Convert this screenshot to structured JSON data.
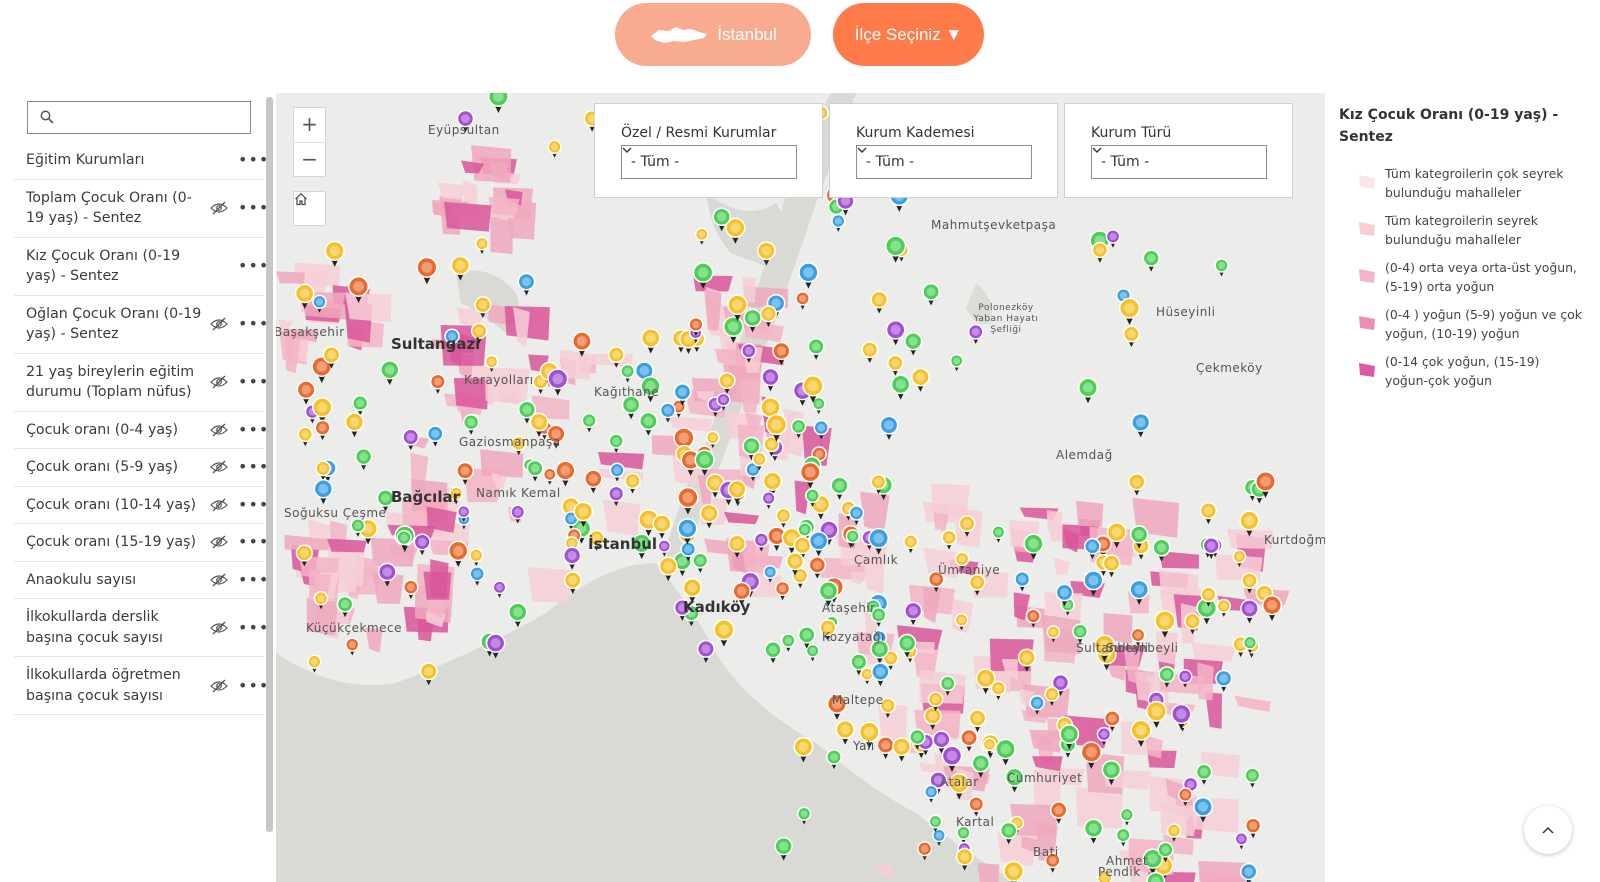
{
  "header": {
    "city_button": "İstanbul",
    "district_button": "İlçe Seçiniz ▼"
  },
  "sidebar": {
    "search_placeholder": "",
    "items": [
      {
        "label": "Eğitim Kurumları",
        "hidden_icon": false
      },
      {
        "label": "Toplam Çocuk Oranı (0-19 yaş) - Sentez",
        "hidden_icon": true
      },
      {
        "label": "Kız Çocuk Oranı (0-19 yaş) - Sentez",
        "hidden_icon": false
      },
      {
        "label": "Oğlan Çocuk Oranı (0-19 yaş) - Sentez",
        "hidden_icon": true
      },
      {
        "label": "21 yaş bireylerin eğitim durumu (Toplam nüfus)",
        "hidden_icon": true
      },
      {
        "label": "Çocuk oranı (0-4 yaş)",
        "hidden_icon": true
      },
      {
        "label": "Çocuk oranı (5-9 yaş)",
        "hidden_icon": true
      },
      {
        "label": "Çocuk oranı (10-14 yaş)",
        "hidden_icon": true
      },
      {
        "label": "Çocuk oranı (15-19 yaş)",
        "hidden_icon": true
      },
      {
        "label": "Anaokulu sayısı",
        "hidden_icon": true
      },
      {
        "label": "İlkokullarda derslik başına çocuk sayısı",
        "hidden_icon": true
      },
      {
        "label": "İlkokullarda öğretmen başına çocuk sayısı",
        "hidden_icon": true
      }
    ]
  },
  "filters": [
    {
      "title": "Özel / Resmi Kurumlar",
      "selected": "- Tüm -"
    },
    {
      "title": "Kurum Kademesi",
      "selected": "- Tüm -"
    },
    {
      "title": "Kurum Türü",
      "selected": "- Tüm -"
    }
  ],
  "map": {
    "zoom_in": "+",
    "zoom_out": "−",
    "place_labels": [
      "Sultangazi",
      "Bağcılar",
      "İstanbul",
      "Kadıköy",
      "Başakşehir",
      "Gaziosmanpaşa",
      "Kağıthane",
      "Karayolları",
      "Namık Kemal",
      "Soğuksu Çeşme",
      "Küçükçekmece",
      "Ataşehir",
      "Kozyatağı",
      "Çamlık",
      "Ümraniye",
      "Maltepe",
      "Yalı",
      "Atalar",
      "Kartal",
      "Cumhuriyet",
      "Sultanbeyli",
      "Pendik",
      "Kurtdoğmuş",
      "Hüseyinli",
      "Çekmeköy",
      "Mahmutşevketpaşa",
      "Alemdağ",
      "Polonezköy Yaban Hayatı Şefliği",
      "Eyüpsultan",
      "Sultanbeyli",
      "Bati",
      "Ahmet"
    ],
    "colors": {
      "water": "#d9d9d6",
      "land": "#ececea",
      "pink_light": "#f6cfd6",
      "pink_mid": "#efa8bd",
      "pink_dark": "#d9569a",
      "marker_yellow": "#f5c22a",
      "marker_green": "#4bcf57",
      "marker_purple": "#a24fd3",
      "marker_blue": "#3aa0e2",
      "marker_orange": "#e86a2c"
    }
  },
  "legend": {
    "title": "Kız Çocuk Oranı (0-19 yaş) - Sentez",
    "items": [
      {
        "label": "Tüm kategroilerin çok seyrek bulunduğu mahalleler",
        "color": "#fbe6e4"
      },
      {
        "label": "Tüm kategroilerin seyrek bulunduğu mahalleler",
        "color": "#f7cfd3"
      },
      {
        "label": "(0-4) orta veya orta-üst yoğun, (5-19) orta yoğun",
        "color": "#f3b4c6"
      },
      {
        "label": "(0-4 ) yoğun (5-9) yoğun ve çok yoğun, (10-19) yoğun",
        "color": "#ec8fb5"
      },
      {
        "label": "(0-14 çok yoğun, (15-19) yoğun-çok yoğun",
        "color": "#dc5aa6"
      }
    ]
  }
}
